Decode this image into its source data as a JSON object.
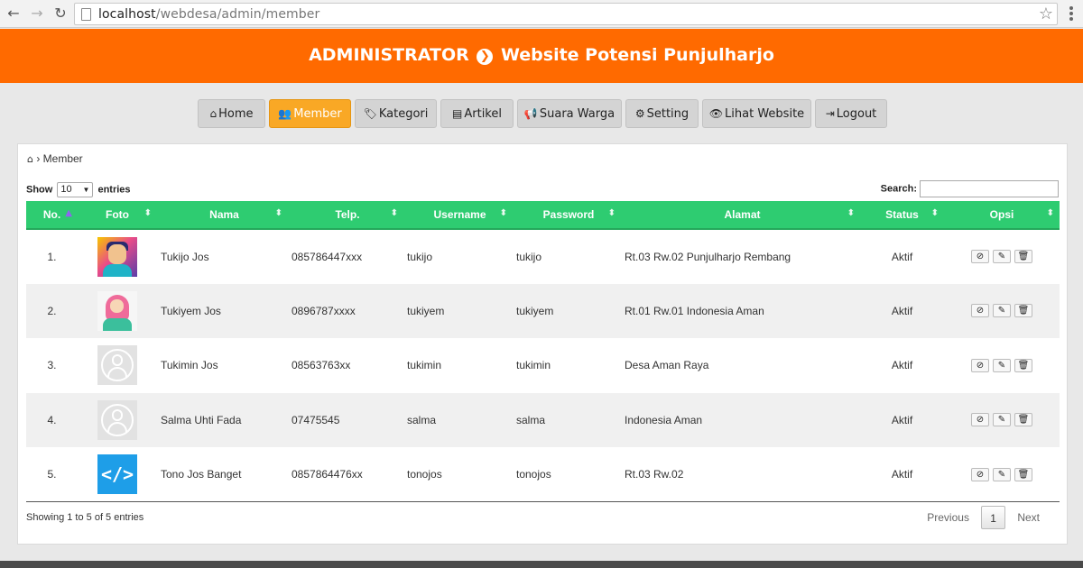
{
  "browser": {
    "url_host": "localhost",
    "url_path": "/webdesa/admin/member",
    "back_icon": "back-arrow-icon",
    "forward_icon": "forward-arrow-icon",
    "reload_icon": "reload-icon",
    "star_icon": "bookmark-star-icon"
  },
  "header": {
    "title_left": "ADMINISTRATOR",
    "title_right": "Website Potensi Punjulharjo",
    "color": "#ff6a00"
  },
  "nav": {
    "items": [
      {
        "label": "Home",
        "icon": "home-icon"
      },
      {
        "label": "Member",
        "icon": "users-icon",
        "active": true
      },
      {
        "label": "Kategori",
        "icon": "tags-icon"
      },
      {
        "label": "Artikel",
        "icon": "newspaper-icon"
      },
      {
        "label": "Suara Warga",
        "icon": "megaphone-icon"
      },
      {
        "label": "Setting",
        "icon": "gear-icon"
      },
      {
        "label": "Lihat Website",
        "icon": "eye-icon"
      },
      {
        "label": "Logout",
        "icon": "sign-out-icon"
      }
    ],
    "active_color": "#f9a825"
  },
  "breadcrumb": {
    "current": "Member"
  },
  "table_controls": {
    "show_label": "Show",
    "page_size": "10",
    "entries_label": "entries",
    "search_label": "Search:",
    "search_value": ""
  },
  "table": {
    "header_color": "#2ecc71",
    "columns": [
      "No.",
      "Foto",
      "Nama",
      "Telp.",
      "Username",
      "Password",
      "Alamat",
      "Status",
      "Opsi"
    ],
    "rows": [
      {
        "no": "1.",
        "foto": "avatar-illustration-man",
        "nama": "Tukijo Jos",
        "telp": "085786447xxx",
        "username": "tukijo",
        "password": "tukijo",
        "alamat": "Rt.03 Rw.02 Punjulharjo Rembang",
        "status": "Aktif"
      },
      {
        "no": "2.",
        "foto": "avatar-illustration-hijab",
        "nama": "Tukiyem Jos",
        "telp": "0896787xxxx",
        "username": "tukiyem",
        "password": "tukiyem",
        "alamat": "Rt.01 Rw.01 Indonesia Aman",
        "status": "Aktif"
      },
      {
        "no": "3.",
        "foto": "avatar-default",
        "nama": "Tukimin Jos",
        "telp": "08563763xx",
        "username": "tukimin",
        "password": "tukimin",
        "alamat": "Desa Aman Raya",
        "status": "Aktif"
      },
      {
        "no": "4.",
        "foto": "avatar-default",
        "nama": "Salma Uhti Fada",
        "telp": "07475545",
        "username": "salma",
        "password": "salma",
        "alamat": "Indonesia Aman",
        "status": "Aktif"
      },
      {
        "no": "5.",
        "foto": "avatar-code",
        "nama": "Tono Jos Banget",
        "telp": "0857864476xx",
        "username": "tonojos",
        "password": "tonojos",
        "alamat": "Rt.03 Rw.02",
        "status": "Aktif"
      }
    ]
  },
  "footer": {
    "info": "Showing 1 to 5 of 5 entries",
    "previous": "Previous",
    "page": "1",
    "next": "Next"
  }
}
